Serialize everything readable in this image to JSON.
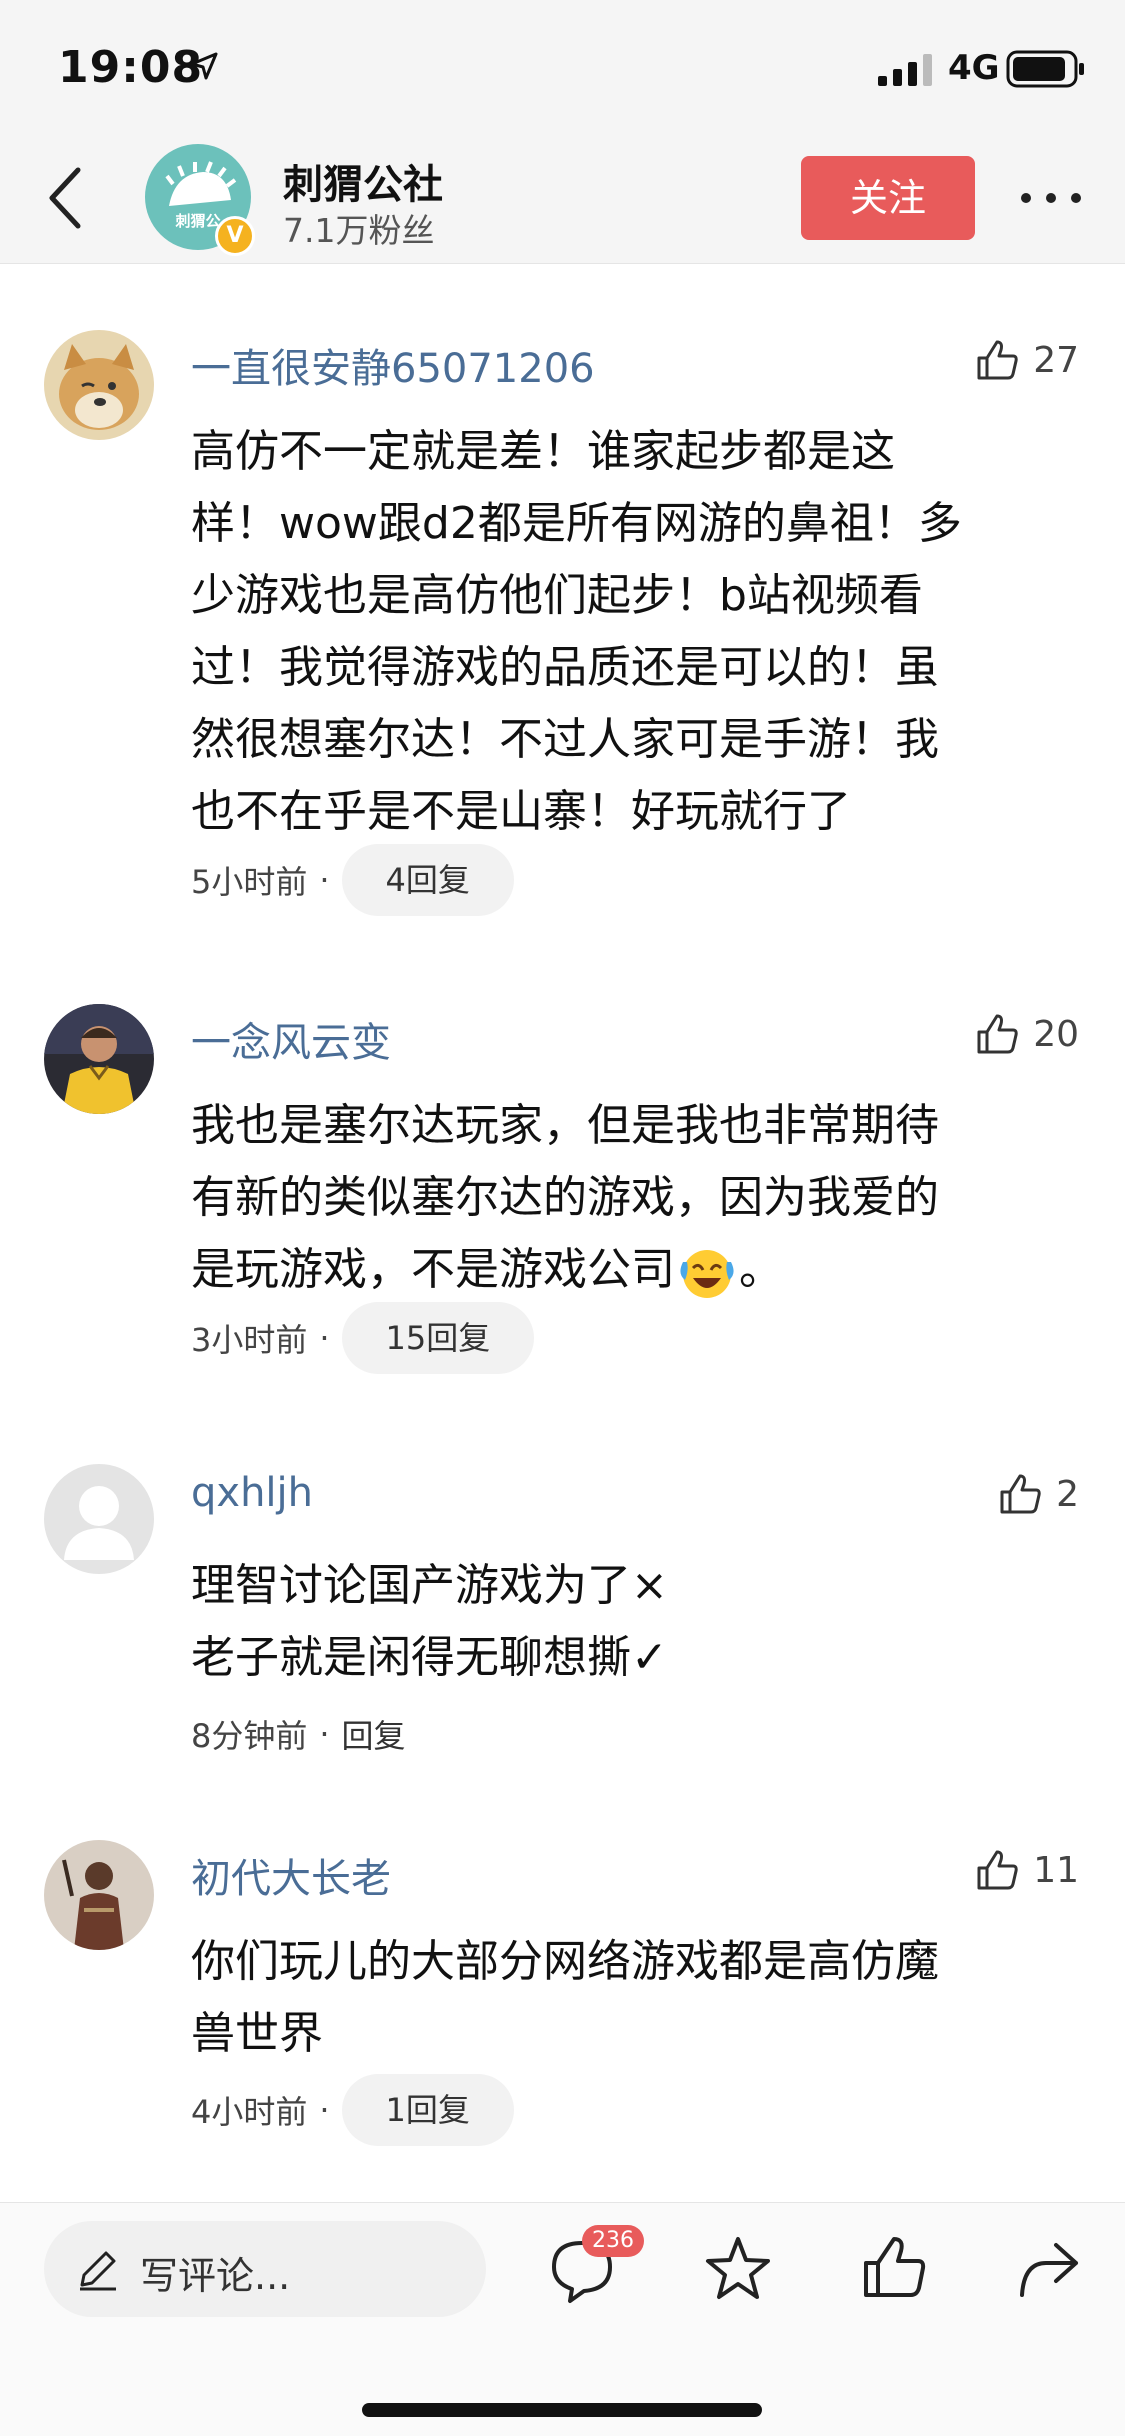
{
  "status_bar": {
    "time": "19:08",
    "network": "4G"
  },
  "header": {
    "avatar_text": "刺猬公",
    "verified_mark": "V",
    "channel_name": "刺猬公社",
    "fans": "7.1万粉丝",
    "follow_label": "关注"
  },
  "comments": [
    {
      "user": "一直很安静65071206",
      "likes": "27",
      "text": "高仿不一定就是差！谁家起步都是这\n样！wow跟d2都是所有网游的鼻祖！多\n少游戏也是高仿他们起步！b站视频看\n过！我觉得游戏的品质还是可以的！虽\n然很想塞尔达！不过人家可是手游！我\n也不在乎是不是山寨！好玩就行了",
      "time": "5小时前",
      "replies": "4回复"
    },
    {
      "user": "一念风云变",
      "likes": "20",
      "text_before_emoji": "我也是塞尔达玩家，但是我也非常期待\n有新的类似塞尔达的游戏，因为我爱的\n是玩游戏，不是游戏公司",
      "text_after_emoji": "。",
      "emoji": "laughing-crying-emoji",
      "time": "3小时前",
      "replies": "15回复"
    },
    {
      "user": "qxhljh",
      "likes": "2",
      "text": "理智讨论国产游戏为了×\n老子就是闲得无聊想撕✓",
      "time": "8分钟前",
      "replies": "回复"
    },
    {
      "user": "初代大长老",
      "likes": "11",
      "text": "你们玩儿的大部分网络游戏都是高仿魔\n兽世界",
      "time": "4小时前",
      "replies": "1回复"
    }
  ],
  "bottom_bar": {
    "placeholder": "写评论...",
    "comment_count": "236"
  },
  "colors": {
    "accent_red": "#e85b5b",
    "username_blue": "#4a6d96",
    "avatar_teal": "#6cc1bb",
    "verified_gold": "#f5b21f"
  }
}
